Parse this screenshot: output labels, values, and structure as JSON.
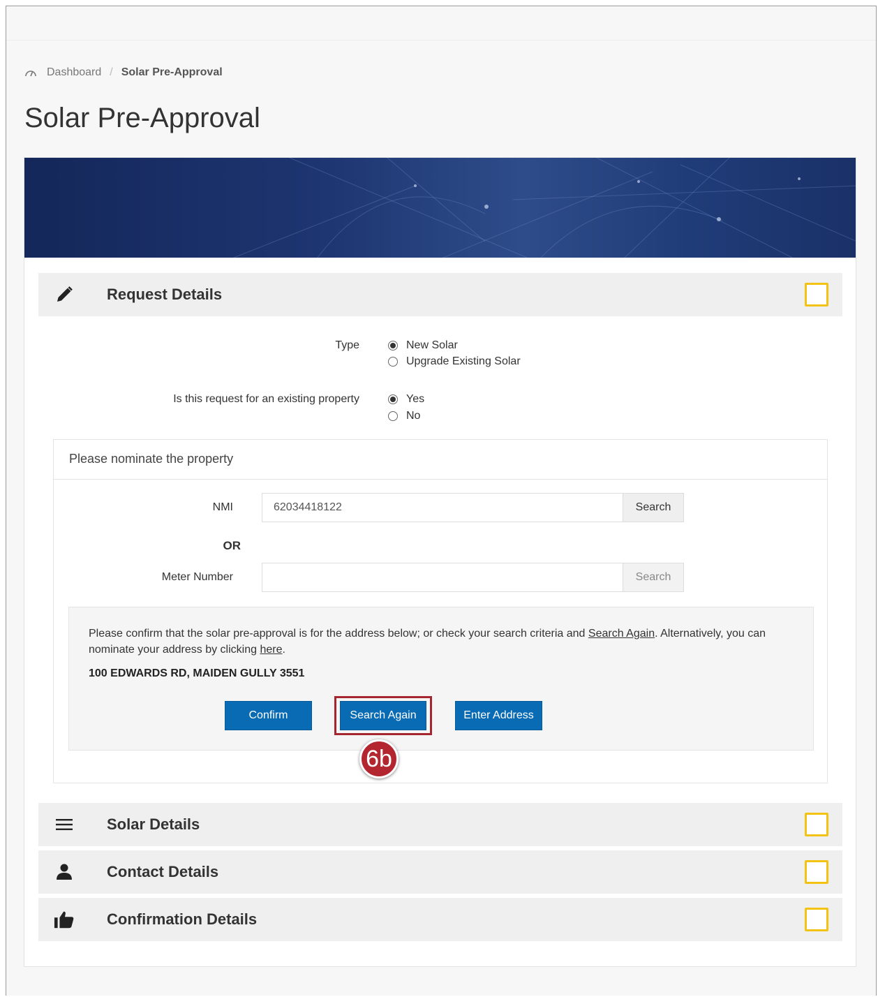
{
  "breadcrumb": {
    "home": "Dashboard",
    "separator": "/",
    "current": "Solar Pre-Approval"
  },
  "page": {
    "title": "Solar Pre-Approval"
  },
  "request_details": {
    "title": "Request Details",
    "type_label": "Type",
    "type_options": [
      "New Solar",
      "Upgrade Existing Solar"
    ],
    "type_selected": "New Solar",
    "existing_label": "Is this request for an existing property",
    "existing_options": [
      "Yes",
      "No"
    ],
    "existing_selected": "Yes"
  },
  "property": {
    "heading": "Please nominate the property",
    "nmi_label": "NMI",
    "nmi_value": "62034418122",
    "nmi_search": "Search",
    "or_label": "OR",
    "meter_label": "Meter Number",
    "meter_value": "",
    "meter_search": "Search",
    "confirm_text_1": "Please confirm that the solar pre-approval is for the address below; or check your search criteria and ",
    "confirm_link_1": "Search Again",
    "confirm_text_2": ". Alternatively, you can nominate your address by clicking ",
    "confirm_link_2": "here",
    "confirm_text_3": ".",
    "address": "100 EDWARDS RD, MAIDEN GULLY 3551",
    "confirm_btn": "Confirm",
    "search_again_btn": "Search Again",
    "enter_address_btn": "Enter Address"
  },
  "callout": {
    "label": "6b"
  },
  "sections": {
    "solar": "Solar Details",
    "contact": "Contact Details",
    "confirmation": "Confirmation Details"
  },
  "colors": {
    "primary": "#0a6bb5",
    "status": "#f2c315",
    "highlight": "#a6262f",
    "banner": "#1d3570"
  }
}
